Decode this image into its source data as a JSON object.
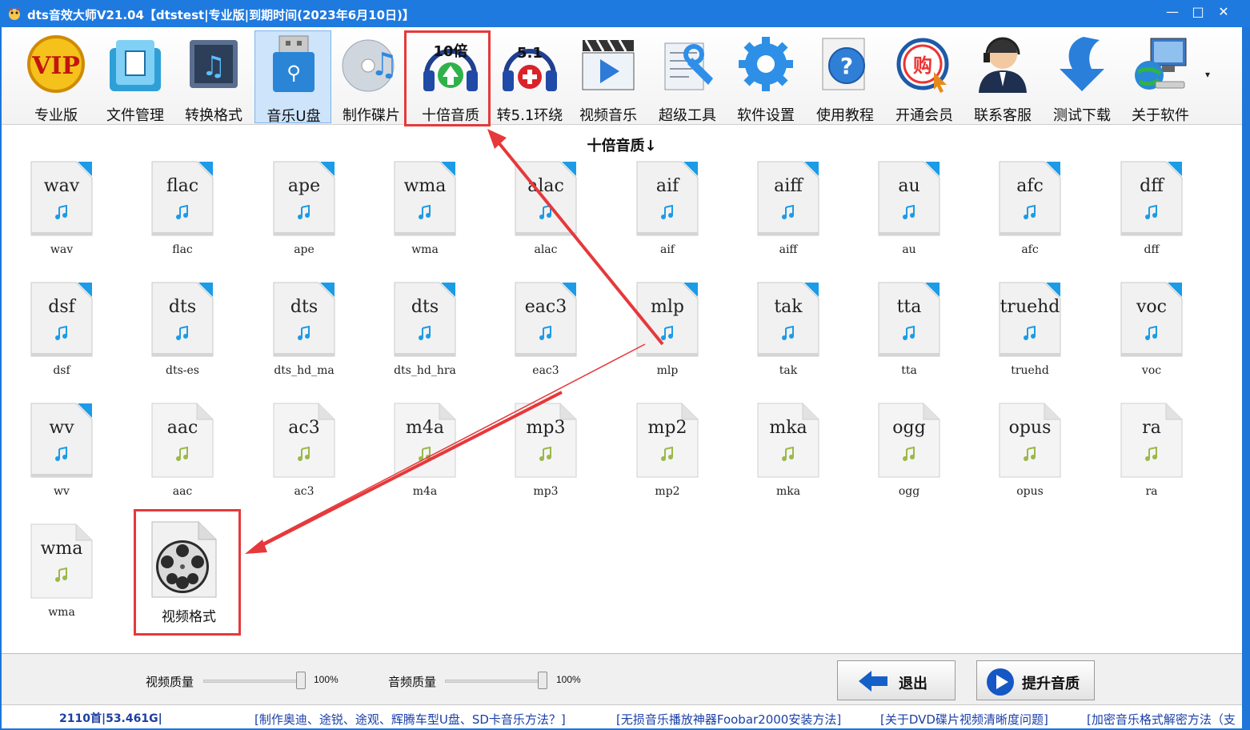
{
  "window": {
    "title": "dts音效大师V21.04【dtstest|专业版|到期时间(2023年6月10日)】",
    "minimize": "—",
    "maximize": "□",
    "close": "✕"
  },
  "toolbar": {
    "items": [
      {
        "label": "专业版",
        "icon": "vip-icon"
      },
      {
        "label": "文件管理",
        "icon": "folder-icon"
      },
      {
        "label": "转换格式",
        "icon": "music-convert-icon"
      },
      {
        "label": "音乐U盘",
        "icon": "usb-drive-icon"
      },
      {
        "label": "制作碟片",
        "icon": "cd-music-icon"
      },
      {
        "label": "十倍音质",
        "icon": "tenx-quality-icon",
        "badge": "10倍"
      },
      {
        "label": "转5.1环绕",
        "icon": "surround-51-icon",
        "badge": "5.1"
      },
      {
        "label": "视频音乐",
        "icon": "video-clapper-icon"
      },
      {
        "label": "超级工具",
        "icon": "super-tools-icon"
      },
      {
        "label": "软件设置",
        "icon": "gear-icon"
      },
      {
        "label": "使用教程",
        "icon": "help-icon",
        "badge": "?"
      },
      {
        "label": "开通会员",
        "icon": "membership-icon",
        "badge": "购"
      },
      {
        "label": "联系客服",
        "icon": "customer-service-icon"
      },
      {
        "label": "测试下载",
        "icon": "download-arrow-icon"
      },
      {
        "label": "关于软件",
        "icon": "computer-globe-icon"
      }
    ],
    "selected_index": 3,
    "more": "▾"
  },
  "content": {
    "section_title": "十倍音质↓",
    "lossless_formats": [
      {
        "ext": "wav",
        "label": "wav"
      },
      {
        "ext": "flac",
        "label": "flac"
      },
      {
        "ext": "ape",
        "label": "ape"
      },
      {
        "ext": "wma",
        "label": "wma"
      },
      {
        "ext": "alac",
        "label": "alac"
      },
      {
        "ext": "aif",
        "label": "aif"
      },
      {
        "ext": "aiff",
        "label": "aiff"
      },
      {
        "ext": "au",
        "label": "au"
      },
      {
        "ext": "afc",
        "label": "afc"
      },
      {
        "ext": "dff",
        "label": "dff"
      },
      {
        "ext": "dsf",
        "label": "dsf"
      },
      {
        "ext": "dts",
        "label": "dts-es"
      },
      {
        "ext": "dts",
        "label": "dts_hd_ma"
      },
      {
        "ext": "dts",
        "label": "dts_hd_hra"
      },
      {
        "ext": "eac3",
        "label": "eac3"
      },
      {
        "ext": "mlp",
        "label": "mlp"
      },
      {
        "ext": "tak",
        "label": "tak"
      },
      {
        "ext": "tta",
        "label": "tta"
      },
      {
        "ext": "truehd",
        "label": "truehd"
      },
      {
        "ext": "voc",
        "label": "voc"
      },
      {
        "ext": "wv",
        "label": "wv"
      }
    ],
    "lossy_formats": [
      {
        "ext": "aac",
        "label": "aac"
      },
      {
        "ext": "ac3",
        "label": "ac3"
      },
      {
        "ext": "m4a",
        "label": "m4a"
      },
      {
        "ext": "mp3",
        "label": "mp3"
      },
      {
        "ext": "mp2",
        "label": "mp2"
      },
      {
        "ext": "mka",
        "label": "mka"
      },
      {
        "ext": "ogg",
        "label": "ogg"
      },
      {
        "ext": "opus",
        "label": "opus"
      },
      {
        "ext": "ra",
        "label": "ra"
      },
      {
        "ext": "wma",
        "label": "wma"
      }
    ],
    "video_format": {
      "label": "视频格式",
      "icon": "film-reel-icon"
    }
  },
  "bottom": {
    "video_quality": {
      "label": "视频质量",
      "value": 100,
      "display": "100%"
    },
    "audio_quality": {
      "label": "音频质量",
      "value": 100,
      "display": "100%"
    },
    "exit_label": "退出",
    "boost_label": "提升音质"
  },
  "status": {
    "count": "2110首|53.461G|",
    "links": [
      "[制作奥迪、途锐、途观、辉腾车型U盘、SD卡音乐方法？]",
      "[无损音乐播放神器Foobar2000安装方法]",
      "[关于DVD碟片视频清晰度问题]",
      "[加密音乐格式解密方法（支"
    ]
  },
  "colors": {
    "titlebar": "#1f7ae0",
    "highlight": "#e5393b",
    "lossless_note": "#1c9be6",
    "lossy_note": "#9bb84a",
    "doc_corner": "#1c9be6",
    "link": "#1a3fa8"
  }
}
